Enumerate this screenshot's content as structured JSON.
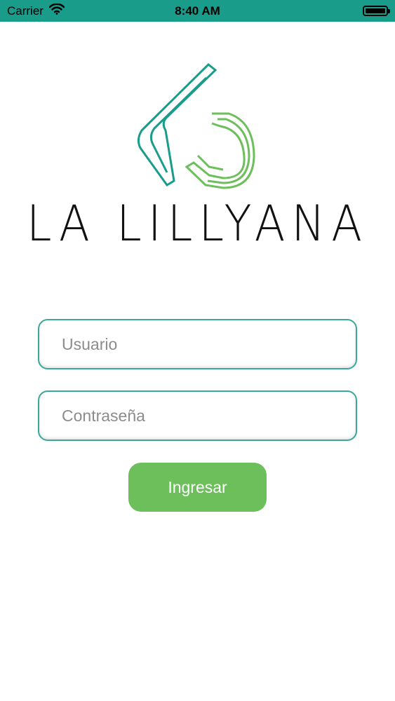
{
  "status_bar": {
    "carrier": "Carrier",
    "time": "8:40 AM"
  },
  "brand": {
    "name": "LA LILLYANA"
  },
  "login_form": {
    "username_placeholder": "Usuario",
    "username_value": "",
    "password_placeholder": "Contraseña",
    "password_value": "",
    "submit_label": "Ingresar"
  },
  "icons": {
    "wifi": "wifi-icon",
    "battery": "battery-icon",
    "logo": "logo-icon"
  },
  "colors": {
    "status_bar_bg": "#1a9c8a",
    "field_border": "#3aa99a",
    "button_bg": "#6dbf5b",
    "logo_teal": "#1a9c8a",
    "logo_green": "#6dbf5b"
  }
}
